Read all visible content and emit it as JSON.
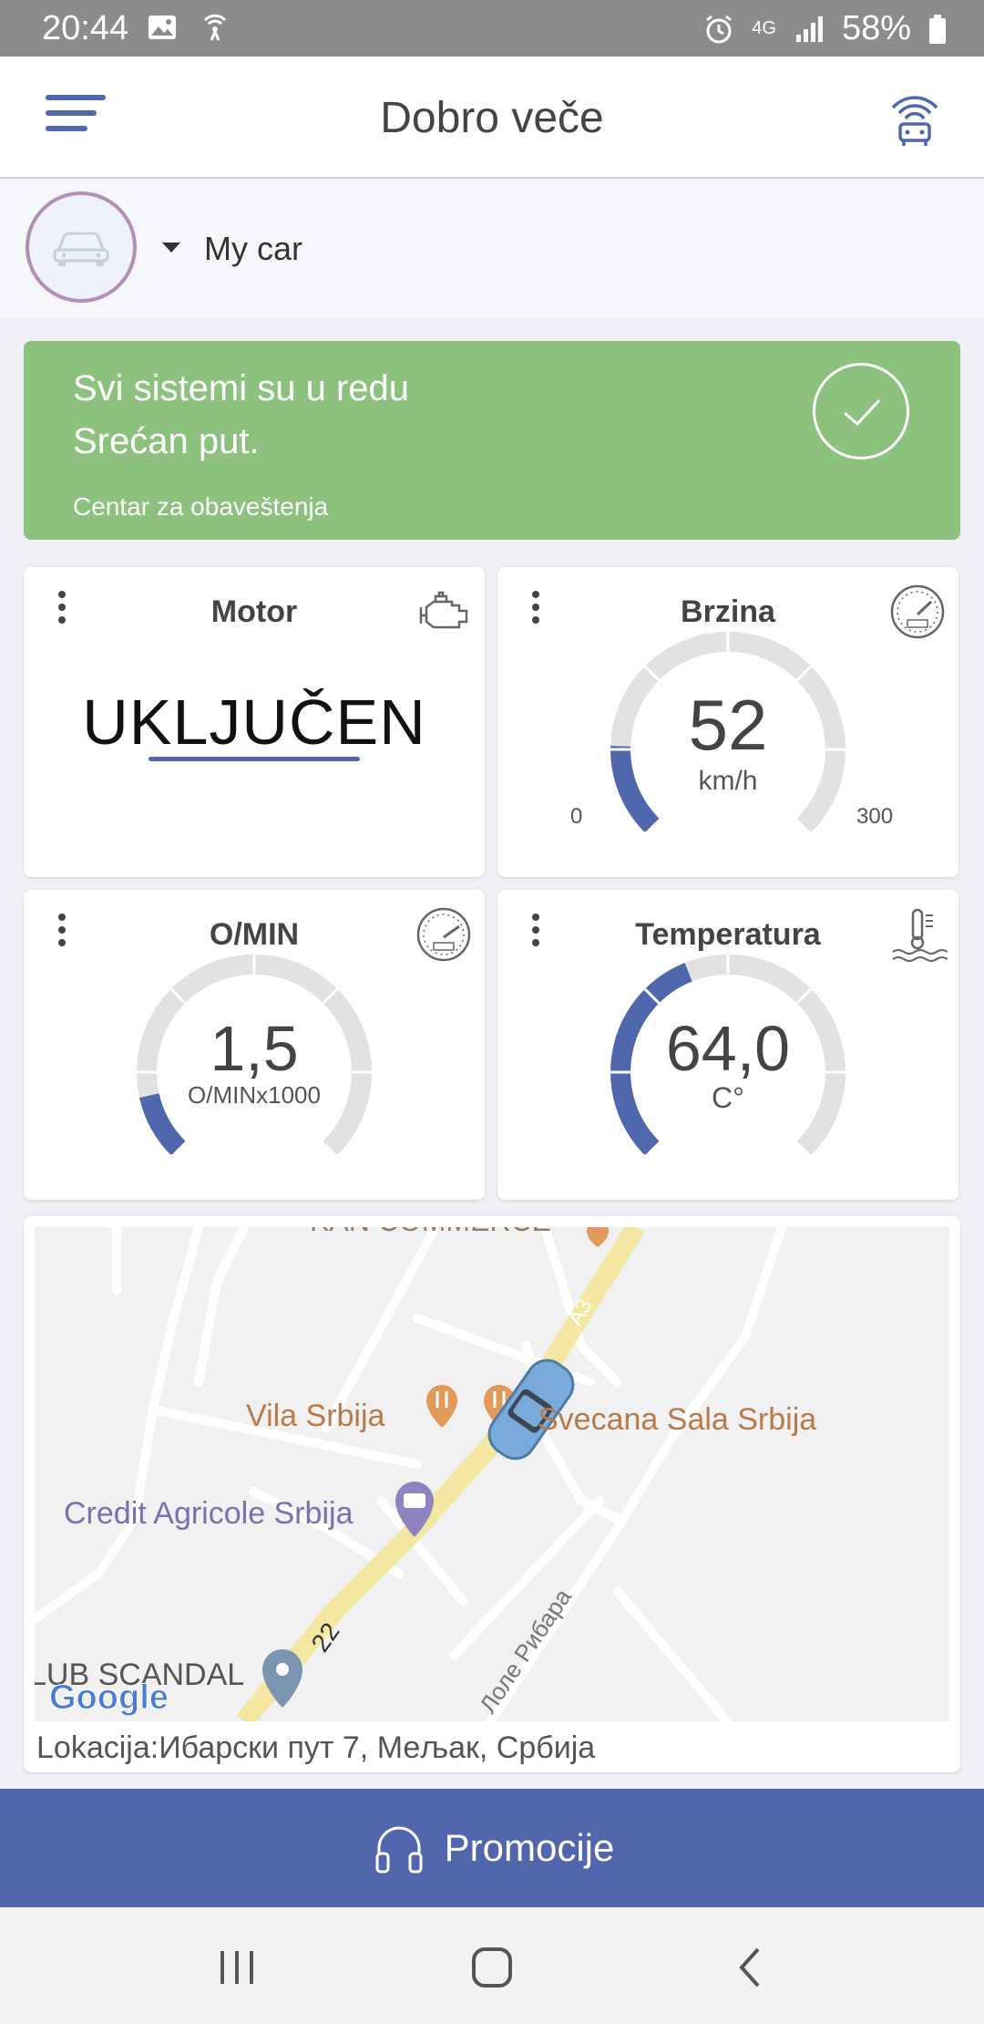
{
  "status_bar": {
    "time": "20:44",
    "network": "4G",
    "battery": "58%"
  },
  "app_bar": {
    "title": "Dobro veče"
  },
  "car_selector": {
    "name": "My car"
  },
  "status_banner": {
    "line1": "Svi sistemi su u redu",
    "line2": "Srećan put.",
    "link": "Centar za obaveštenja",
    "color": "#8dc17e"
  },
  "cards": {
    "motor": {
      "title": "Motor",
      "value": "UKLJUČEN"
    },
    "speed": {
      "title": "Brzina",
      "value": "52",
      "unit": "km/h",
      "min": "0",
      "max": "300",
      "fraction": 0.173
    },
    "rpm": {
      "title": "O/MIN",
      "value": "1,5",
      "unit": "O/MINx1000",
      "fraction": 0.12
    },
    "temp": {
      "title": "Temperatura",
      "value": "64,0",
      "unit": "C°",
      "fraction": 0.42
    }
  },
  "map": {
    "labels": {
      "poi_top": "KAN COMMERCE",
      "vila": "Vila Srbija",
      "sala": "Svecana Sala Srbija",
      "credit": "Credit Agricole Srbija",
      "scandal": "LUB SCANDAL",
      "road_num": "22",
      "road_num2": "A3",
      "street": "Лоле Рибара",
      "google": "Google"
    }
  },
  "location": {
    "label": "Lokacija:",
    "address": "Ибарски пут 7, Мељак, Србија"
  },
  "promo_button": {
    "label": "Promocije"
  },
  "colors": {
    "accent": "#5266ad",
    "gauge_fill": "#4f67ad",
    "gauge_track": "#e2e2e2"
  }
}
